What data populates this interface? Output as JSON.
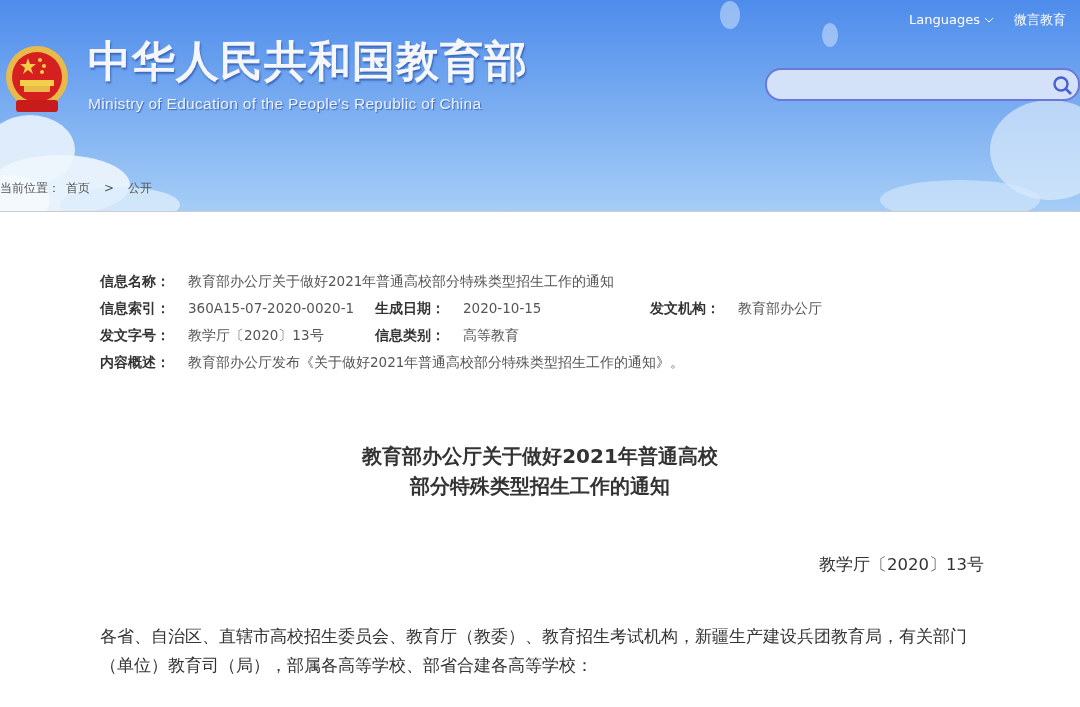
{
  "header": {
    "title_cn": "中华人民共和国教育部",
    "title_en": "Ministry of Education of the People's Republic of China",
    "languages": "Languages",
    "weibo": "微言教育"
  },
  "breadcrumb": {
    "label": "当前位置：",
    "items": [
      "首页",
      "公开"
    ],
    "separator": ">"
  },
  "info": [
    [
      {
        "label": "信息名称：",
        "value": "教育部办公厅关于做好2021年普通高校部分特殊类型招生工作的通知"
      }
    ],
    [
      {
        "label": "信息索引：",
        "value": "360A15-07-2020-0020-1"
      },
      {
        "label": "生成日期：",
        "value": "2020-10-15"
      },
      {
        "label": "发文机构：",
        "value": "教育部办公厅"
      }
    ],
    [
      {
        "label": "发文字号：",
        "value": "教学厅〔2020〕13号"
      },
      {
        "label": "信息类别：",
        "value": "高等教育"
      }
    ],
    [
      {
        "label": "内容概述：",
        "value": "教育部办公厅发布《关于做好2021年普通高校部分特殊类型招生工作的通知》。"
      }
    ]
  ],
  "article": {
    "title_lines": [
      "教育部办公厅关于做好2021年普通高校",
      "部分特殊类型招生工作的通知"
    ],
    "doc_number": "教学厅〔2020〕13号",
    "paragraphs": [
      "各省、自治区、直辖市高校招生委员会、教育厅（教委）、教育招生考试机构，新疆生产建设兵团教育局，有关部门（单位）教育司（局），部属各高等学校、部省合建各高等学校："
    ]
  }
}
